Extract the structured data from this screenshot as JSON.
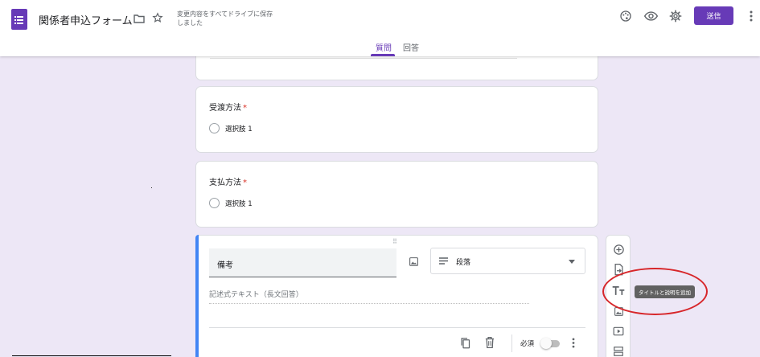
{
  "header": {
    "title": "関係者申込フォーム",
    "save_status": "変更内容をすべてドライブに保存しました",
    "send_label": "送信"
  },
  "tabs": [
    {
      "label": "質問",
      "active": true
    },
    {
      "label": "回答",
      "active": false
    }
  ],
  "questions": [
    {
      "title": "受渡方法",
      "required_mark": "*",
      "options": [
        "選択肢 1"
      ]
    },
    {
      "title": "支払方法",
      "required_mark": "*",
      "options": [
        "選択肢 1"
      ]
    }
  ],
  "active_question": {
    "title": "備考",
    "type_label": "段落",
    "answer_placeholder": "記述式テキスト（長文回答）",
    "required_label": "必須",
    "required_on": false
  },
  "toolbar": {
    "tooltip": "タイトルと説明を追加"
  },
  "colors": {
    "accent": "#673ab7",
    "background": "#ede7f6",
    "active_bar": "#4285f4",
    "annotation": "#d7262a"
  },
  "icons": {
    "header": [
      "forms-app-icon",
      "folder-icon",
      "star-icon",
      "palette-icon",
      "eye-icon",
      "gear-icon",
      "more-vert-icon"
    ],
    "toolbar": [
      "add-circle-icon",
      "import-icon",
      "title-icon",
      "image-icon",
      "video-icon",
      "section-icon"
    ],
    "footer": [
      "copy-icon",
      "trash-icon",
      "more-vert-icon"
    ]
  }
}
